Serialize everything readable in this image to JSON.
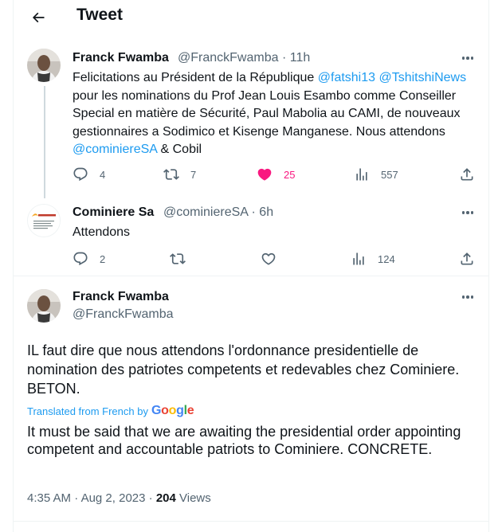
{
  "header": {
    "title": "Tweet"
  },
  "tweets": [
    {
      "author_name": "Franck Fwamba",
      "author_handle": "@FranckFwamba",
      "sep": "·",
      "time": "11h",
      "text": {
        "t1": "Felicitations au Président de la République ",
        "m1": "@fatshi13",
        "m2": "@TshitshiNews",
        "t2": " pour les nominations du Prof Jean Louis Esambo comme Conseiller Special en matière de Sécurité, Paul Mabolia au CAMI, de nouveaux gestionnaires a Sodimico et Kisenge Manganese. Nous attendons ",
        "m3": "@cominiereSA",
        "t3": " & Cobil"
      },
      "replies": "4",
      "retweets": "7",
      "likes": "25",
      "views": "557",
      "liked_color": "#f91880"
    },
    {
      "author_name": "Cominiere Sa",
      "author_handle": "@cominiereSA",
      "sep": "·",
      "time": "6h",
      "text": "Attendons",
      "replies": "2",
      "retweets": "",
      "likes": "",
      "views": "124"
    }
  ],
  "main_tweet": {
    "author_name": "Franck Fwamba",
    "author_handle": "@FranckFwamba",
    "text": "IL faut dire que nous attendons l'ordonnance presidentielle de nomination des patriotes competents et redevables chez Cominiere. BETON.",
    "translated_label": "Translated from French by",
    "translator": "Google",
    "translation": "It must be said that we are awaiting the presidential order appointing competent and accountable patriots to Cominiere. CONCRETE.",
    "time": "4:35 AM",
    "date": "Aug 2, 2023",
    "sep": "·",
    "views_count": "204",
    "views_label": "Views"
  },
  "colors": {
    "accent": "#1d9bf0",
    "like": "#f91880",
    "secondary": "#536471"
  }
}
